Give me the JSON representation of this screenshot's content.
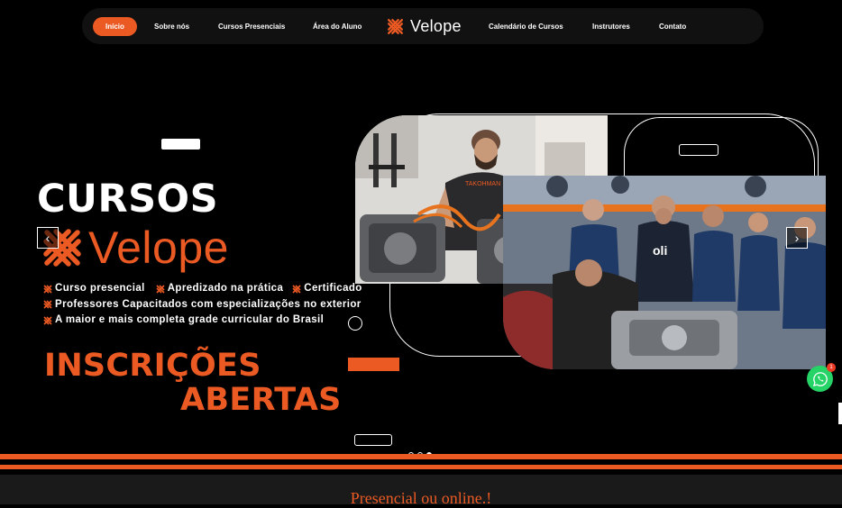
{
  "nav": {
    "items": [
      {
        "label": "Início",
        "active": true
      },
      {
        "label": "Sobre nós"
      },
      {
        "label": "Cursos Presenciais"
      },
      {
        "label": "Área do Aluno"
      },
      {
        "label": "Calendário de Cursos"
      },
      {
        "label": "Instrutores"
      },
      {
        "label": "Contato"
      }
    ],
    "logo_text": "Velope"
  },
  "hero": {
    "title": "CURSOS",
    "brand": "Velope",
    "bullets": [
      [
        "Curso presencial",
        "Apredizado na prática",
        "Certificado"
      ],
      [
        "Professores Capacitados com especializações no exterior"
      ],
      [
        "A maior e mais completa grade curricular do Brasil"
      ]
    ],
    "cta_line1": "INSCRIÇÕES",
    "cta_line2": "ABERTAS",
    "prev_icon": "chevron-left-icon",
    "next_icon": "chevron-right-icon",
    "slide_count": 3,
    "active_slide": 3
  },
  "photos": {
    "photo1": {
      "shirt_text": "TAKOHMAN"
    },
    "photo2": {
      "shirt_text": "oli"
    }
  },
  "whatsapp": {
    "badge": "1",
    "icon": "whatsapp-icon"
  },
  "bottom": {
    "heading": "Presencial ou online.!"
  },
  "colors": {
    "accent": "#ec5a24",
    "background": "#000000",
    "whatsapp": "#25d366"
  }
}
